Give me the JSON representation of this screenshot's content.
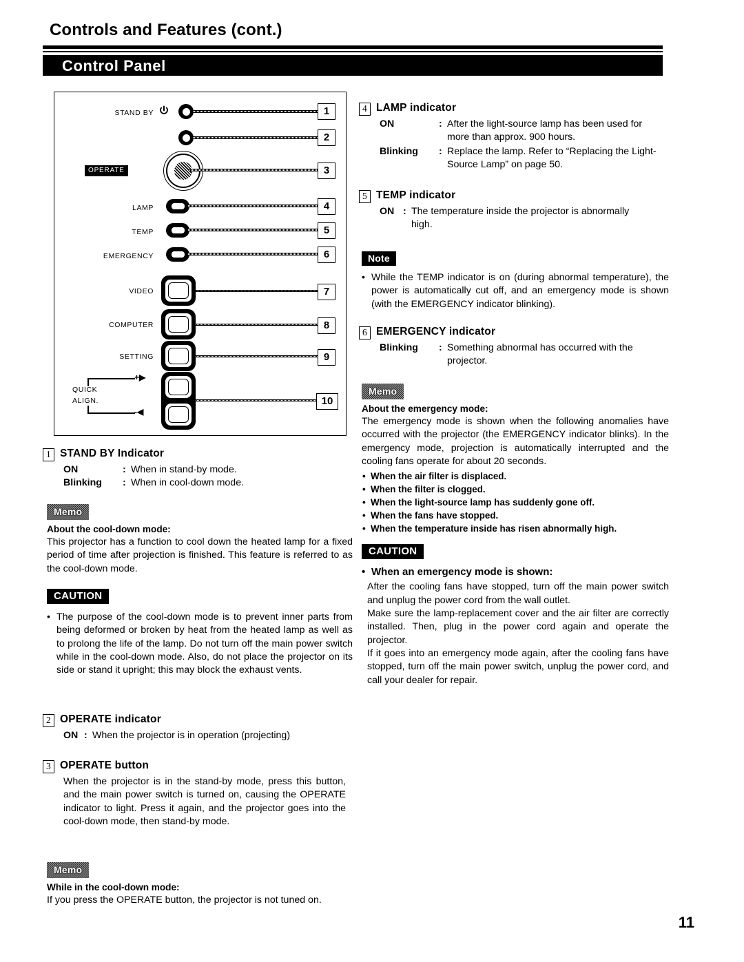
{
  "header": {
    "title": "Controls and Features (cont.)",
    "section": "Control Panel"
  },
  "diagram": {
    "labels": {
      "stand_by": "STAND BY",
      "operate": "OPERATE",
      "lamp": "LAMP",
      "temp": "TEMP",
      "emergency": "EMERGENCY",
      "video": "VIDEO",
      "computer": "COMPUTER",
      "setting": "SETTING",
      "quick": "QUICK",
      "align": "ALIGN."
    },
    "power_icon": "power-symbol",
    "quick_align": {
      "plus": "+▶",
      "minus": "-◀"
    },
    "callouts": [
      "1",
      "2",
      "3",
      "4",
      "5",
      "6",
      "7",
      "8",
      "9",
      "10"
    ]
  },
  "left_column": {
    "standby": {
      "num": "1",
      "title": "STAND BY Indicator",
      "rows": [
        {
          "key": "ON",
          "colon": ":",
          "value": "When in stand-by mode."
        },
        {
          "key": "Blinking",
          "colon": ":",
          "value": "When in cool-down mode."
        }
      ]
    },
    "memo_cooldown": {
      "badge": "Memo",
      "sub": "About the cool-down mode:",
      "text": "This projector has a function to cool down the heated lamp for a fixed period of time after projection is finished. This feature is referred to as the cool-down mode."
    },
    "caution_cooldown": {
      "badge": "CAUTION",
      "text": "The purpose of the cool-down mode is to prevent inner parts from being deformed or broken by heat from the heated lamp as well as to prolong the life of the lamp. Do not turn off the main power switch while in the cool-down mode. Also, do not place the projector on its side or stand it upright; this may block the exhaust vents."
    },
    "operate_indicator": {
      "num": "2",
      "title": "OPERATE indicator",
      "rows": [
        {
          "key": "ON",
          "colon": ":",
          "value": "When the projector is in operation (projecting)"
        }
      ]
    },
    "operate_button": {
      "num": "3",
      "title": "OPERATE button",
      "text": "When the projector is in the stand-by mode, press this button, and the main power switch is turned on, causing the OPERATE indicator to light. Press it again, and the projector goes into the cool-down mode, then stand-by mode."
    },
    "memo_cooldown2": {
      "badge": "Memo",
      "sub": "While in the cool-down mode:",
      "text": "If you press the OPERATE button, the projector is not tuned on."
    }
  },
  "right_column": {
    "lamp": {
      "num": "4",
      "title": "LAMP indicator",
      "rows": [
        {
          "key": "ON",
          "colon": ":",
          "value": "After the light-source lamp has been used for",
          "cont": "more than approx. 900 hours."
        },
        {
          "key": "Blinking",
          "colon": ":",
          "value": "Replace the lamp. Refer to “Replacing the Light-",
          "cont": "Source Lamp” on page 50."
        }
      ]
    },
    "temp": {
      "num": "5",
      "title": "TEMP indicator",
      "rows": [
        {
          "key": "ON",
          "colon": ":",
          "value": "The temperature inside the projector is abnormally",
          "cont": "high."
        }
      ]
    },
    "note_temp": {
      "badge": "Note",
      "text": "While the TEMP indicator is on (during abnormal temperature), the power is automatically cut off, and an emergency mode is shown (with the EMERGENCY indicator blinking)."
    },
    "emergency": {
      "num": "6",
      "title": "EMERGENCY indicator",
      "rows": [
        {
          "key": "Blinking",
          "colon": ":",
          "value": "Something abnormal has occurred with the",
          "cont": "projector."
        }
      ]
    },
    "memo_emergency": {
      "badge": "Memo",
      "sub": "About the emergency mode:",
      "text": "The emergency mode is shown when the following anomalies have occurred with the projector (the EMERGENCY indicator blinks). In the emergency mode, projection is automatically interrupted and the cooling fans operate for about 20 seconds.",
      "bullets": [
        "When the air filter is displaced.",
        "When the filter is clogged.",
        "When the light-source lamp has suddenly gone off.",
        "When the fans have stopped.",
        "When the temperature inside has risen abnormally high."
      ]
    },
    "caution_emergency": {
      "badge": "CAUTION",
      "sub": "When an emergency mode is shown:",
      "paragraphs": [
        "After the cooling fans have stopped, turn off the main power switch and unplug the power cord from the wall outlet.",
        "Make sure the lamp-replacement cover and the air filter are correctly installed. Then, plug in the power cord again and operate the projector.",
        "If it goes into an emergency mode again, after the cooling fans have stopped, turn off the main power switch, unplug the power cord, and call your dealer for repair."
      ]
    }
  },
  "footer": {
    "page_number": "11"
  }
}
